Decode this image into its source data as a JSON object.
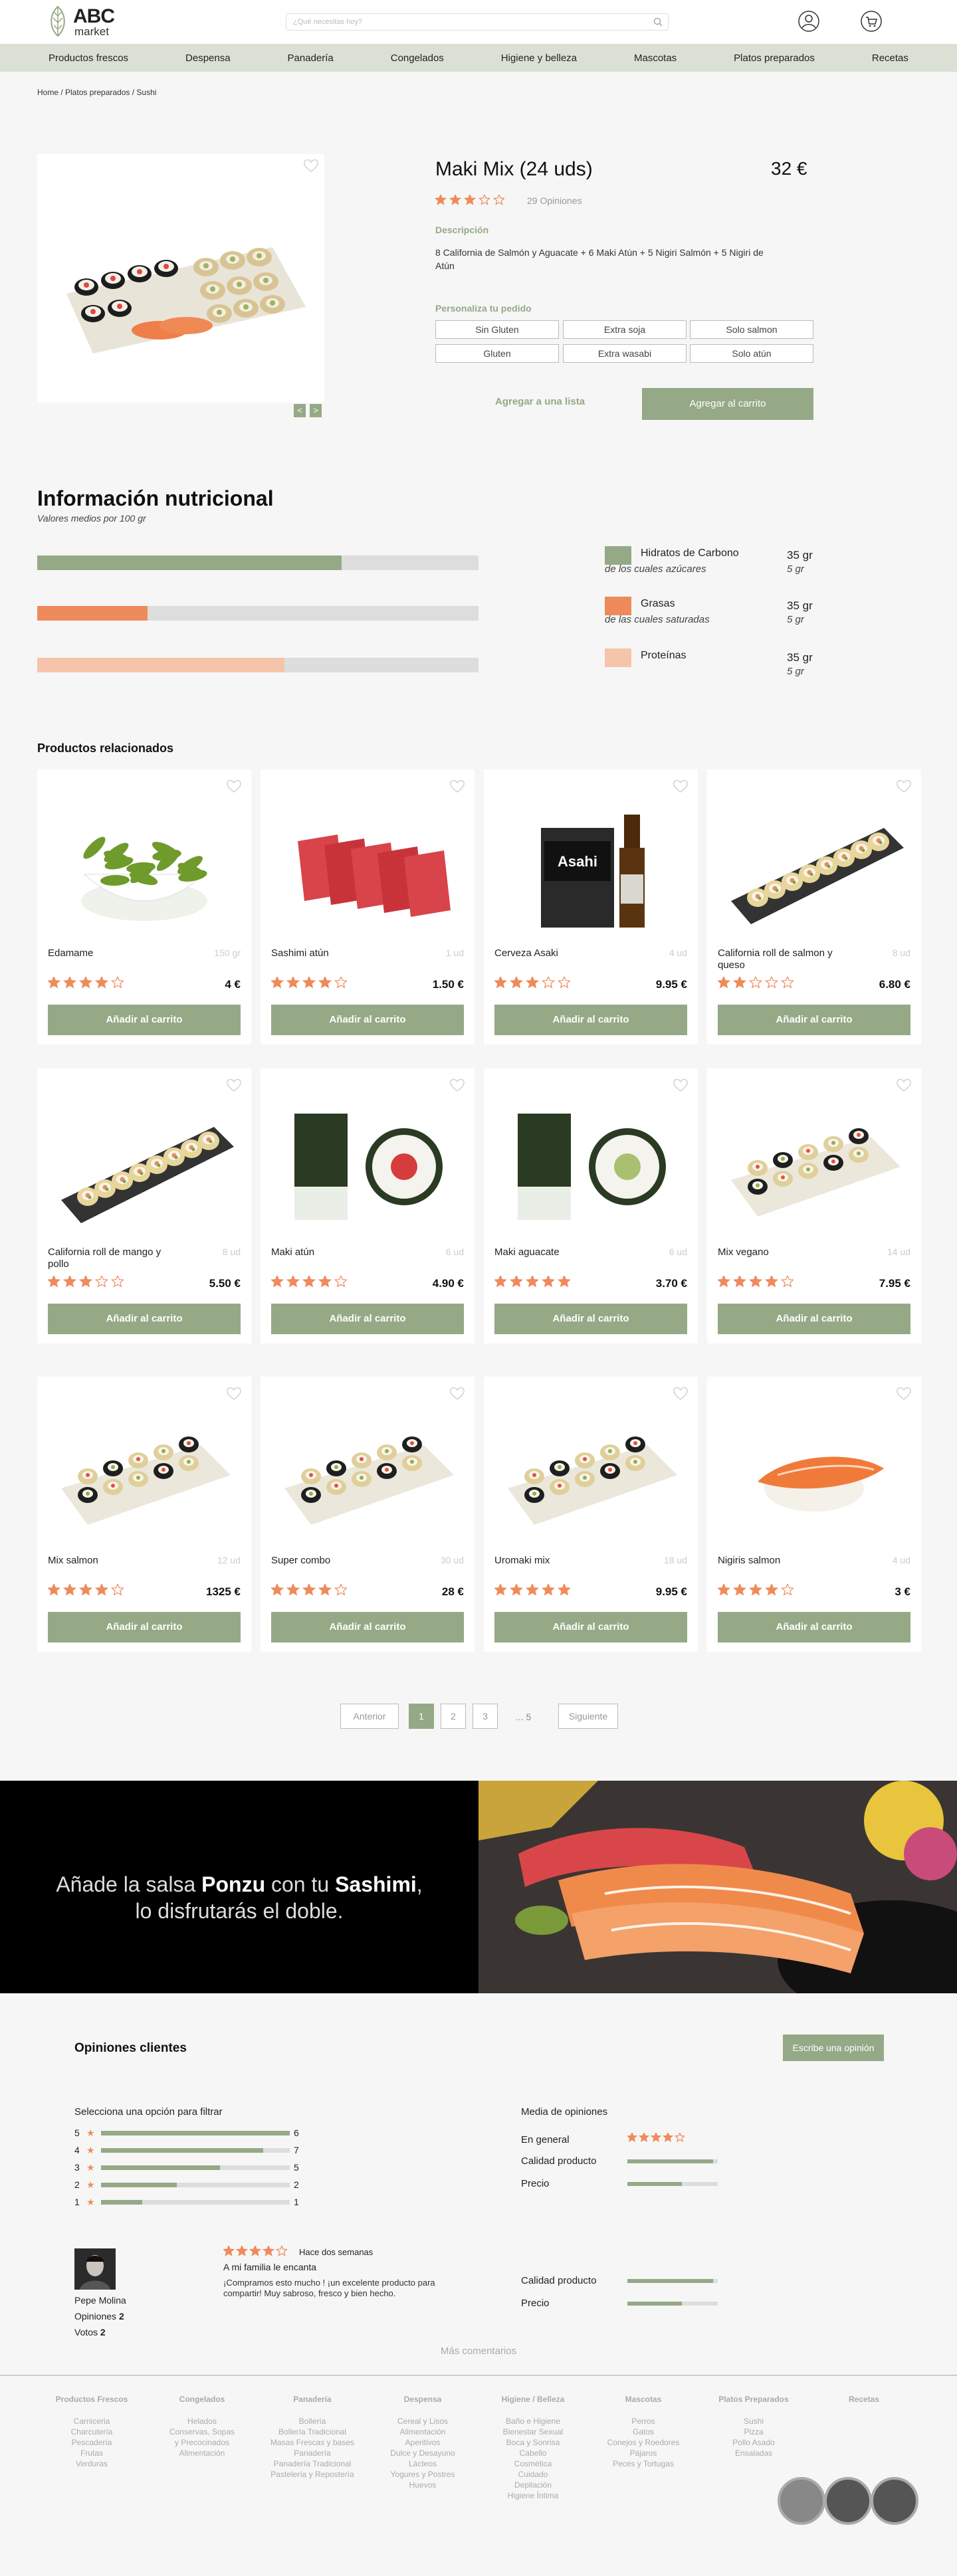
{
  "header": {
    "logo_line1": "ABC",
    "logo_line2": "market",
    "search_placeholder": "¿Qué necesitas hoy?"
  },
  "nav": [
    "Productos frescos",
    "Despensa",
    "Panadería",
    "Congelados",
    "Higiene y belleza",
    "Mascotas",
    "Platos preparados",
    "Recetas"
  ],
  "breadcrumb": "Home / Platos preparados / Sushi",
  "product": {
    "title": "Maki Mix (24 uds)",
    "price": "32 €",
    "rating": 3,
    "reviews": "29 Opiniones",
    "desc_title": "Descripción",
    "description": "8 California de Salmón y Aguacate + 6 Maki Atún + 5 Nigiri Salmón + 5 Nigiri de Atún",
    "customize_title": "Personaliza tu pedido",
    "options": [
      "Sin Gluten",
      "Extra soja",
      "Solo salmon",
      "Gluten",
      "Extra wasabi",
      "Solo atún"
    ],
    "add_list": "Agregar a una lista",
    "add_cart": "Agregar al carrito",
    "prev_arrow": "<",
    "next_arrow": ">"
  },
  "nutrition": {
    "title": "Información nutricional",
    "subtitle": "Valores medios por 100 gr",
    "items": [
      {
        "name": "Hidratos de Carbono",
        "sub": "de los cuales azúcares",
        "value": "35 gr",
        "subvalue": "5 gr",
        "fraction": 0.69,
        "color": "#95a986"
      },
      {
        "name": "Grasas",
        "sub": "de las cuales saturadas",
        "value": "35 gr",
        "subvalue": "5 gr",
        "fraction": 0.25,
        "color": "#ef8a5b"
      },
      {
        "name": "Proteínas",
        "sub": "",
        "value": "35 gr",
        "subvalue": "5 gr",
        "fraction": 0.56,
        "color": "#f6c4aa"
      }
    ]
  },
  "related": {
    "title": "Productos relacionados",
    "add_label": "Añadir al carrito",
    "items": [
      {
        "name": "Edamame",
        "qty": "150 gr",
        "price": "4 €",
        "rating": 4,
        "icon": "edamame"
      },
      {
        "name": "Sashimi atún",
        "qty": "1 ud",
        "price": "1.50 €",
        "rating": 4,
        "icon": "sashimi-tuna"
      },
      {
        "name": "Cerveza Asaki",
        "qty": "4 ud",
        "price": "9.95 €",
        "rating": 3,
        "icon": "beer"
      },
      {
        "name": "California roll de salmon y queso",
        "qty": "8 ud",
        "price": "6.80 €",
        "rating": 2,
        "icon": "california-roll"
      },
      {
        "name": "California roll de mango y pollo",
        "qty": "8 ud",
        "price": "5.50 €",
        "rating": 3,
        "icon": "california-roll"
      },
      {
        "name": "Maki atún",
        "qty": "6 ud",
        "price": "4.90 €",
        "rating": 4,
        "icon": "maki-tuna"
      },
      {
        "name": "Maki aguacate",
        "qty": "6 ud",
        "price": "3.70 €",
        "rating": 5,
        "icon": "maki-avocado"
      },
      {
        "name": "Mix vegano",
        "qty": "14 ud",
        "price": "7.95 €",
        "rating": 4,
        "icon": "sushi-plate"
      },
      {
        "name": "Mix salmon",
        "qty": "12 ud",
        "price": "1325 €",
        "rating": 4,
        "icon": "sushi-plate"
      },
      {
        "name": "Super combo",
        "qty": "30 ud",
        "price": "28 €",
        "rating": 4,
        "icon": "sushi-plate"
      },
      {
        "name": "Uromaki mix",
        "qty": "18 ud",
        "price": "9.95 €",
        "rating": 5,
        "icon": "sushi-plate"
      },
      {
        "name": "Nigiris salmon",
        "qty": "4 ud",
        "price": "3 €",
        "rating": 4,
        "icon": "nigiri"
      }
    ]
  },
  "pagination": {
    "prev": "Anterior",
    "pages": [
      "1",
      "2",
      "3"
    ],
    "ellipsis": "... 5",
    "next": "Siguiente"
  },
  "banner": {
    "pre": "Añade la salsa ",
    "b1": "Ponzu",
    "mid": " con tu ",
    "b2": "Sashimi",
    "end": ",",
    "line2": "lo disfrutarás el doble."
  },
  "reviews": {
    "title": "Opiniones clientes",
    "write_btn": "Escribe una opinión",
    "filter_title": "Selecciona una opción para filtrar",
    "filters": [
      {
        "stars": "5",
        "count": "6",
        "fraction": 1.0
      },
      {
        "stars": "4",
        "count": "7",
        "fraction": 0.86
      },
      {
        "stars": "3",
        "count": "5",
        "fraction": 0.63
      },
      {
        "stars": "2",
        "count": "2",
        "fraction": 0.4
      },
      {
        "stars": "1",
        "count": "1",
        "fraction": 0.22
      }
    ],
    "media_title": "Media de opiniones",
    "general_label": "En general",
    "general_rating": 4,
    "media": [
      {
        "label": "Calidad producto",
        "fraction": 0.95
      },
      {
        "label": "Precio",
        "fraction": 0.6
      }
    ],
    "review": {
      "name": "Pepe  Molina",
      "opinions_label": "Opiniones",
      "opinions_count": "2",
      "votes_label": "Votos",
      "votes_count": "2",
      "rating": 4,
      "when": "Hace dos semanas",
      "title": "A mi familia le encanta",
      "text": "¡Compramos esto mucho ! ¡un excelente producto para compartir! Muy sabroso, fresco y bien hecho.",
      "scores": [
        {
          "label": "Calidad producto",
          "fraction": 0.95
        },
        {
          "label": "Precio",
          "fraction": 0.6
        }
      ]
    },
    "more": "Más comentarios"
  },
  "footer": {
    "columns": [
      {
        "title": "Productos Frescos",
        "items": [
          "Carniceria",
          "Charcutería",
          "Pescadería",
          "Frutas",
          "Verduras"
        ]
      },
      {
        "title": "Congelados",
        "items": [
          "Helados",
          "Conservas, Sopas",
          "y Precocinados",
          "Alimentación"
        ]
      },
      {
        "title": "Panadería",
        "items": [
          "Bollería",
          "Bollería Tradicional",
          "Masas Frescas y bases",
          "Panadería",
          "Panadería Tradicional",
          "Pastelería y Repostería"
        ]
      },
      {
        "title": "Despensa",
        "items": [
          "Cereal y Lisos",
          "Alimentación",
          "Aperitivos",
          "Dulce y Desayuno",
          "Lácteos",
          "Yogures y Postres",
          "Huevos"
        ]
      },
      {
        "title": "Higiene / Belleza",
        "items": [
          "Baño e Higiene",
          "Bienestar Sexual",
          "Boca y Sonrisa",
          "Cabello",
          "Cosmética",
          "Cuidado",
          "Depilación",
          "Higiene Íntima"
        ]
      },
      {
        "title": "Mascotas",
        "items": [
          "Perros",
          "Gatos",
          "Conejos y Roedores",
          "Pájaros",
          "Peces y Tortugas"
        ]
      },
      {
        "title": "Platos Preparados",
        "items": [
          "Sushi",
          "Pizza",
          "Pollo Asado",
          "Ensaladas"
        ]
      },
      {
        "title": "Recetas",
        "items": []
      }
    ]
  },
  "colors": {
    "accent": "#95a986",
    "star": "#ef8a5b",
    "nav_bg": "#dbe0d5"
  }
}
